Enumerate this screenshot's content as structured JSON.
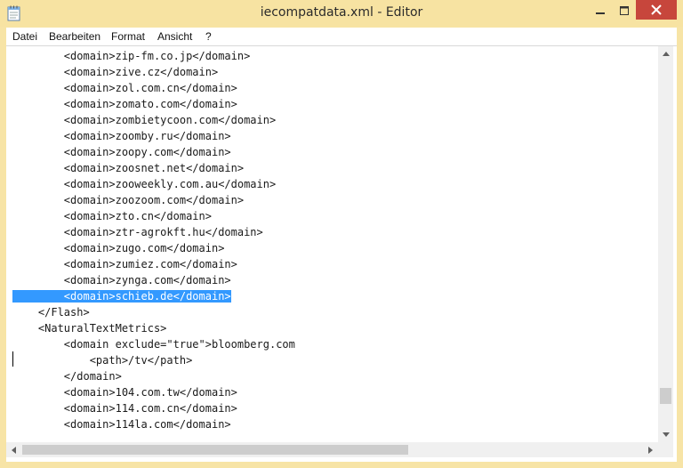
{
  "window": {
    "title": "iecompatdata.xml - Editor",
    "accent": "#f7e3a2",
    "close_color": "#c7463c"
  },
  "icons": {
    "app": "notepad-icon",
    "minimize": "minimize-icon",
    "maximize": "maximize-icon",
    "close": "close-icon",
    "scroll_up": "arrow-up-icon",
    "scroll_down": "arrow-down-icon",
    "scroll_left": "arrow-left-icon",
    "scroll_right": "arrow-right-icon"
  },
  "menu": {
    "items": [
      "Datei",
      "Bearbeiten",
      "Format",
      "Ansicht",
      "?"
    ]
  },
  "editor": {
    "selection_color": "#3399ff",
    "lines": [
      "        <domain>zip-fm.co.jp</domain>",
      "        <domain>zive.cz</domain>",
      "        <domain>zol.com.cn</domain>",
      "        <domain>zomato.com</domain>",
      "        <domain>zombietycoon.com</domain>",
      "        <domain>zoomby.ru</domain>",
      "        <domain>zoopy.com</domain>",
      "        <domain>zoosnet.net</domain>",
      "        <domain>zooweekly.com.au</domain>",
      "        <domain>zoozoom.com</domain>",
      "        <domain>zto.cn</domain>",
      "        <domain>ztr-agrokft.hu</domain>",
      "        <domain>zugo.com</domain>",
      "        <domain>zumiez.com</domain>",
      "        <domain>zynga.com</domain>",
      "        <domain>schieb.de</domain>",
      "    </Flash>",
      "    <NaturalTextMetrics>",
      "        <domain exclude=\"true\">bloomberg.com",
      "            <path>/tv</path>",
      "        </domain>",
      "        <domain>104.com.tw</domain>",
      "        <domain>114.com.cn</domain>",
      "        <domain>114la.com</domain>"
    ],
    "selected_line_index": 15
  }
}
